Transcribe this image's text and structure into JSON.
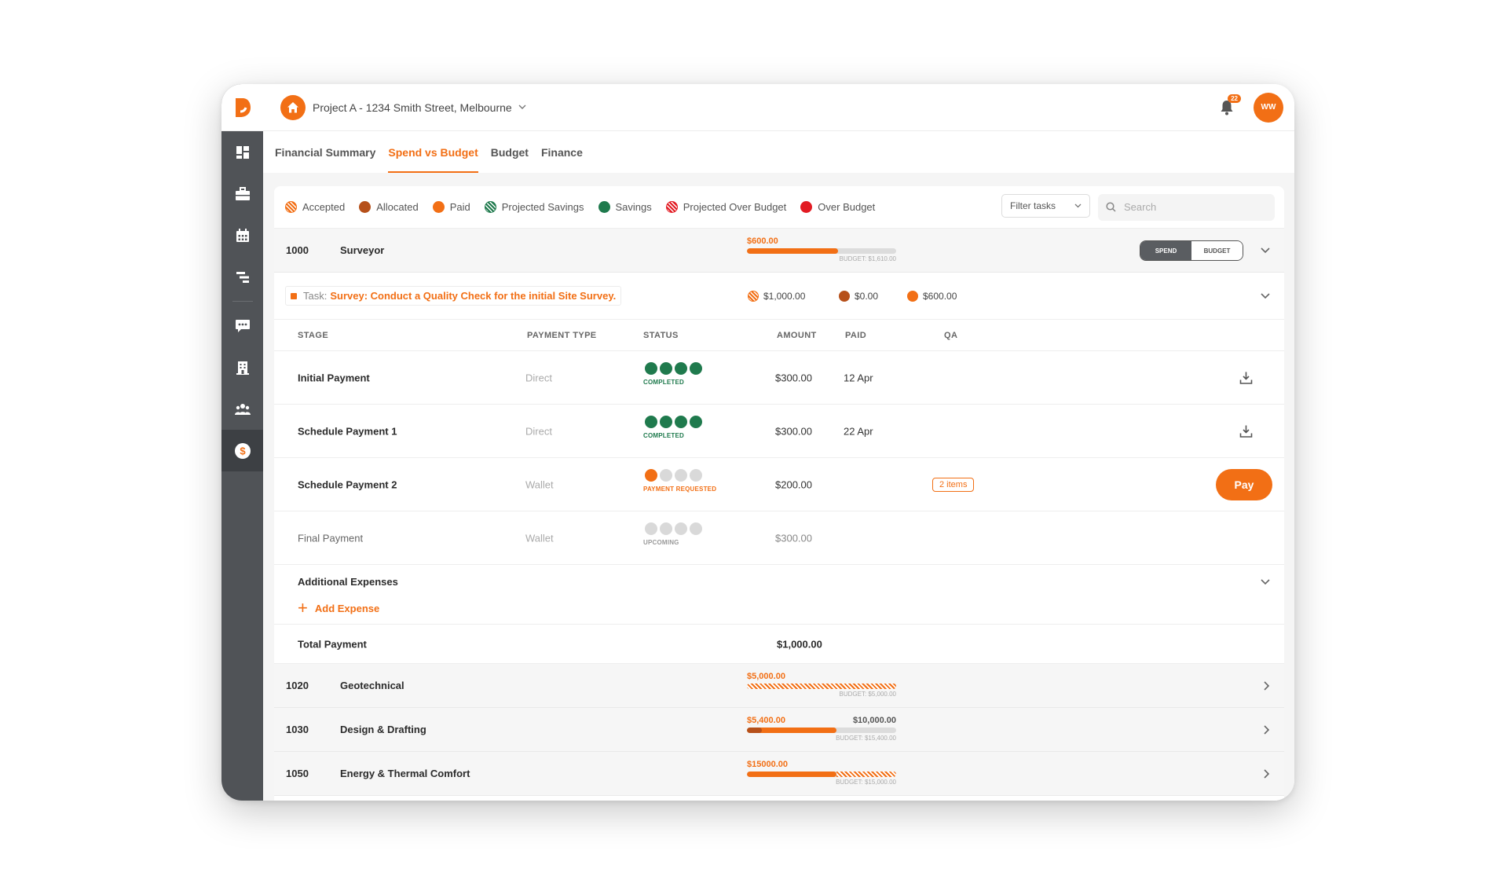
{
  "topbar": {
    "project_name": "Project A - 1234 Smith Street, Melbourne",
    "notification_count": "22",
    "user_initials": "WW"
  },
  "tabs": [
    {
      "label": "Financial Summary",
      "active": false
    },
    {
      "label": "Spend vs Budget",
      "active": true
    },
    {
      "label": "Budget",
      "active": false
    },
    {
      "label": "Finance",
      "active": false
    }
  ],
  "legend": {
    "items": [
      {
        "label": "Accepted",
        "style": "hatch",
        "color": "#f26f15"
      },
      {
        "label": "Allocated",
        "style": "solid",
        "color": "#b6501a"
      },
      {
        "label": "Paid",
        "style": "solid",
        "color": "#f26f15"
      },
      {
        "label": "Projected Savings",
        "style": "hatch",
        "color": "#1f7a4d"
      },
      {
        "label": "Savings",
        "style": "solid",
        "color": "#1f7a4d"
      },
      {
        "label": "Projected Over Budget",
        "style": "hatch",
        "color": "#e21b23"
      },
      {
        "label": "Over Budget",
        "style": "solid",
        "color": "#e21b23"
      }
    ],
    "filter_label": "Filter tasks",
    "search_placeholder": "Search"
  },
  "surveyor": {
    "code": "1000",
    "name": "Surveyor",
    "spent": "$600.00",
    "budget_caption": "BUDGET: $1,610.00",
    "toggle_spend": "SPEND",
    "toggle_budget": "BUDGET"
  },
  "task": {
    "prefix": "Task:",
    "name": "Survey: Conduct a Quality Check for the initial Site Survey.",
    "amounts": [
      "$1,000.00",
      "$0.00",
      "$600.00"
    ]
  },
  "table": {
    "headers": {
      "stage": "STAGE",
      "payment_type": "PAYMENT TYPE",
      "status": "STATUS",
      "amount": "AMOUNT",
      "paid": "PAID",
      "qa": "QA"
    },
    "rows": [
      {
        "stage": "Initial Payment",
        "payment_type": "Direct",
        "status": "COMPLETED",
        "amount": "$300.00",
        "paid": "12 Apr"
      },
      {
        "stage": "Schedule Payment 1",
        "payment_type": "Direct",
        "status": "COMPLETED",
        "amount": "$300.00",
        "paid": "22 Apr"
      },
      {
        "stage": "Schedule Payment 2",
        "payment_type": "Wallet",
        "status": "PAYMENT REQUESTED",
        "amount": "$200.00",
        "paid": "",
        "qa": "2 items",
        "action": "Pay"
      },
      {
        "stage": "Final Payment",
        "payment_type": "Wallet",
        "status": "UPCOMING",
        "amount": "$300.00",
        "paid": ""
      }
    ]
  },
  "additional": {
    "title": "Additional Expenses",
    "add_label": "Add Expense"
  },
  "total": {
    "label": "Total Payment",
    "value": "$1,000.00"
  },
  "groups": [
    {
      "code": "1020",
      "name": "Geotechnical",
      "spent": "$5,000.00",
      "right": "",
      "budget_caption": "BUDGET: $5,000.00"
    },
    {
      "code": "1030",
      "name": "Design & Drafting",
      "spent": "$5,400.00",
      "right": "$10,000.00",
      "budget_caption": "BUDGET: $15,400.00"
    },
    {
      "code": "1050",
      "name": "Energy & Thermal Comfort",
      "spent": "$15000.00",
      "right": "",
      "budget_caption": "BUDGET: $15,000.00"
    }
  ]
}
